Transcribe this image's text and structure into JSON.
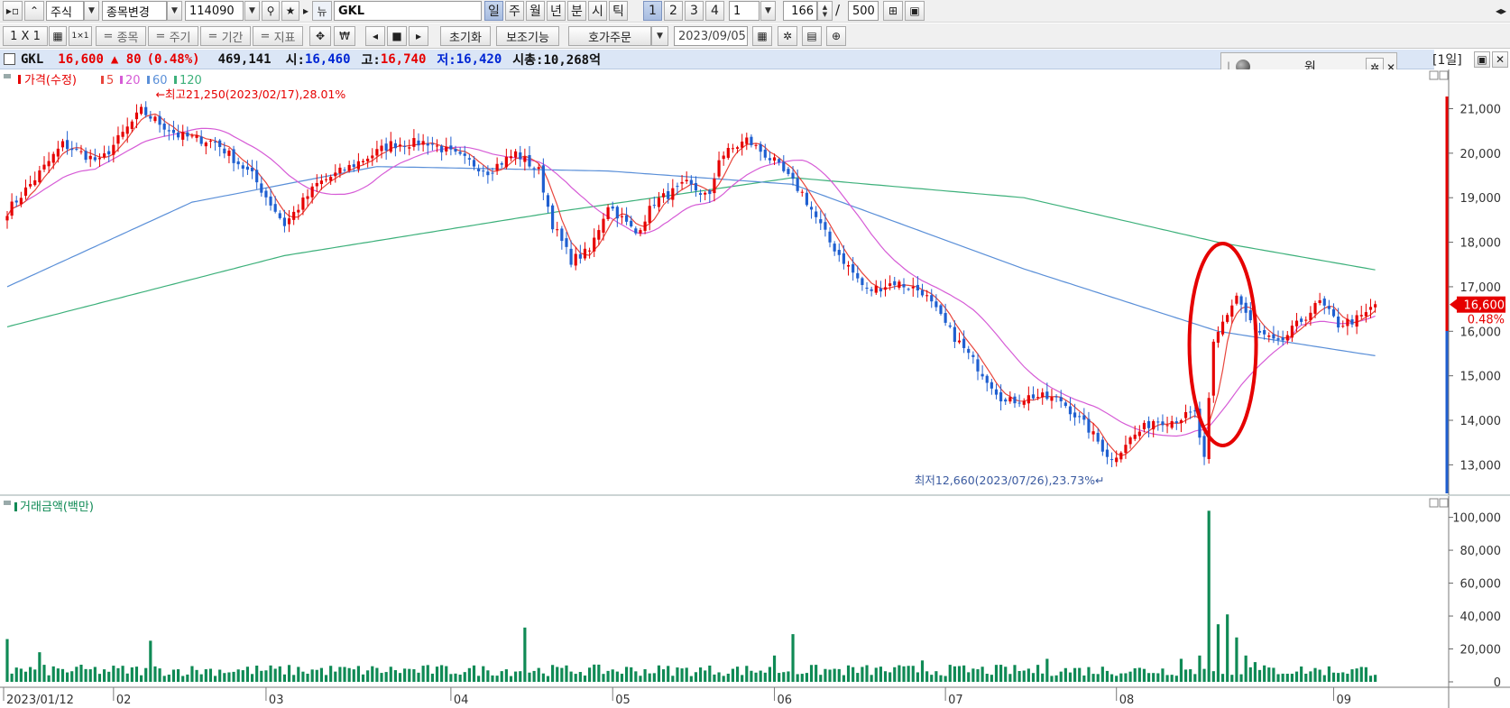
{
  "toolbar1": {
    "market_label": "주식",
    "change_label": "종목변경",
    "code_value": "114090",
    "stock_name": "GKL",
    "periods": [
      "일",
      "주",
      "월",
      "년",
      "분",
      "시",
      "틱"
    ],
    "multipliers": [
      "1",
      "2",
      "3",
      "4"
    ],
    "multiplier_value": "1",
    "count_value": "166",
    "count_max": "500"
  },
  "toolbar2": {
    "layout_label": "1 X 1",
    "opt_buttons": [
      "종목",
      "주기",
      "기간",
      "지표"
    ],
    "reset_label": "초기화",
    "aux_label": "보조기능",
    "order_label": "호가주문",
    "date_value": "2023/09/05"
  },
  "info": {
    "name": "GKL",
    "price": "16,600",
    "change": "▲ 80",
    "change_pct": "(0.48%)",
    "volume": "469,141",
    "open_label": "시:",
    "open": "16,460",
    "high_label": "고:",
    "high": "16,740",
    "low_label": "저:",
    "low": "16,420",
    "mcap_label": "시총:",
    "mcap": "10,268억"
  },
  "unit_panel": {
    "unit": "원"
  },
  "period_label": "[1일]",
  "colors": {
    "up": "#e60000",
    "down": "#1f5fd0",
    "ma5": "#e8453c",
    "ma20": "#d65bd6",
    "ma60": "#5a8fd8",
    "ma120": "#3cb07a",
    "volume": "#0f8a55",
    "annotation": "#e60000"
  },
  "chart_data": [
    {
      "type": "candlestick",
      "legend_title": "가격(수정)",
      "legend": [
        "5",
        "20",
        "60",
        "120"
      ],
      "yticks": [
        "21,000",
        "20,000",
        "19,000",
        "18,000",
        "17,000",
        "16,000",
        "15,000",
        "14,000",
        "13,000"
      ],
      "ylim": [
        12400,
        21800
      ],
      "x_labels": [
        "2023/01/12",
        "02",
        "03",
        "04",
        "05",
        "06",
        "07",
        "08",
        "09"
      ],
      "high_note": "최고21,250(2023/02/17),28.01%",
      "low_note": "최저12,660(2023/07/26),23.73%",
      "current_price": "16,600",
      "current_pct": "0.48%",
      "anchors": [
        [
          0,
          18700
        ],
        [
          5,
          19300
        ],
        [
          12,
          20200
        ],
        [
          20,
          19800
        ],
        [
          29,
          20950
        ],
        [
          37,
          20400
        ],
        [
          45,
          20250
        ],
        [
          53,
          19500
        ],
        [
          60,
          18400
        ],
        [
          67,
          19300
        ],
        [
          76,
          19800
        ],
        [
          83,
          20200
        ],
        [
          91,
          20250
        ],
        [
          98,
          19900
        ],
        [
          104,
          19600
        ],
        [
          110,
          20000
        ],
        [
          115,
          19600
        ],
        [
          118,
          18400
        ],
        [
          122,
          17600
        ],
        [
          126,
          17800
        ],
        [
          130,
          18850
        ],
        [
          136,
          18200
        ],
        [
          140,
          18900
        ],
        [
          147,
          19300
        ],
        [
          152,
          19000
        ],
        [
          154,
          19900
        ],
        [
          160,
          20300
        ],
        [
          166,
          19800
        ],
        [
          172,
          19100
        ],
        [
          178,
          18000
        ],
        [
          186,
          16900
        ],
        [
          192,
          17100
        ],
        [
          198,
          16900
        ],
        [
          204,
          16000
        ],
        [
          210,
          15200
        ],
        [
          216,
          14400
        ],
        [
          222,
          14550
        ],
        [
          228,
          14450
        ],
        [
          234,
          13800
        ],
        [
          239,
          13100
        ],
        [
          242,
          13500
        ],
        [
          248,
          14000
        ],
        [
          252,
          14000
        ],
        [
          257,
          14150
        ],
        [
          259,
          13100
        ],
        [
          261,
          15700
        ],
        [
          263,
          16200
        ],
        [
          266,
          16800
        ],
        [
          270,
          16000
        ],
        [
          275,
          15700
        ],
        [
          281,
          16350
        ],
        [
          284,
          16650
        ],
        [
          288,
          16150
        ],
        [
          293,
          16300
        ],
        [
          296,
          16600
        ]
      ],
      "ma60_anchors": [
        [
          0,
          17000
        ],
        [
          40,
          18900
        ],
        [
          80,
          19700
        ],
        [
          130,
          19600
        ],
        [
          170,
          19300
        ],
        [
          220,
          17400
        ],
        [
          262,
          16000
        ],
        [
          296,
          15450
        ]
      ],
      "ma120_anchors": [
        [
          0,
          16100
        ],
        [
          60,
          17700
        ],
        [
          120,
          18700
        ],
        [
          170,
          19450
        ],
        [
          220,
          19000
        ],
        [
          262,
          18000
        ],
        [
          296,
          17380
        ]
      ]
    },
    {
      "type": "bar",
      "legend_title": "거래금액(백만)",
      "yticks": [
        "100,000",
        "80,000",
        "60,000",
        "40,000",
        "20,000",
        "0"
      ],
      "ylim": [
        0,
        108000
      ],
      "spikes": [
        [
          0,
          26000
        ],
        [
          7,
          18000
        ],
        [
          31,
          25000
        ],
        [
          112,
          33000
        ],
        [
          166,
          16000
        ],
        [
          170,
          29000
        ],
        [
          198,
          13000
        ],
        [
          225,
          14000
        ],
        [
          254,
          14000
        ],
        [
          258,
          16000
        ],
        [
          260,
          104000
        ],
        [
          262,
          35000
        ],
        [
          264,
          41000
        ],
        [
          266,
          27000
        ],
        [
          268,
          16000
        ],
        [
          270,
          12000
        ]
      ]
    }
  ]
}
